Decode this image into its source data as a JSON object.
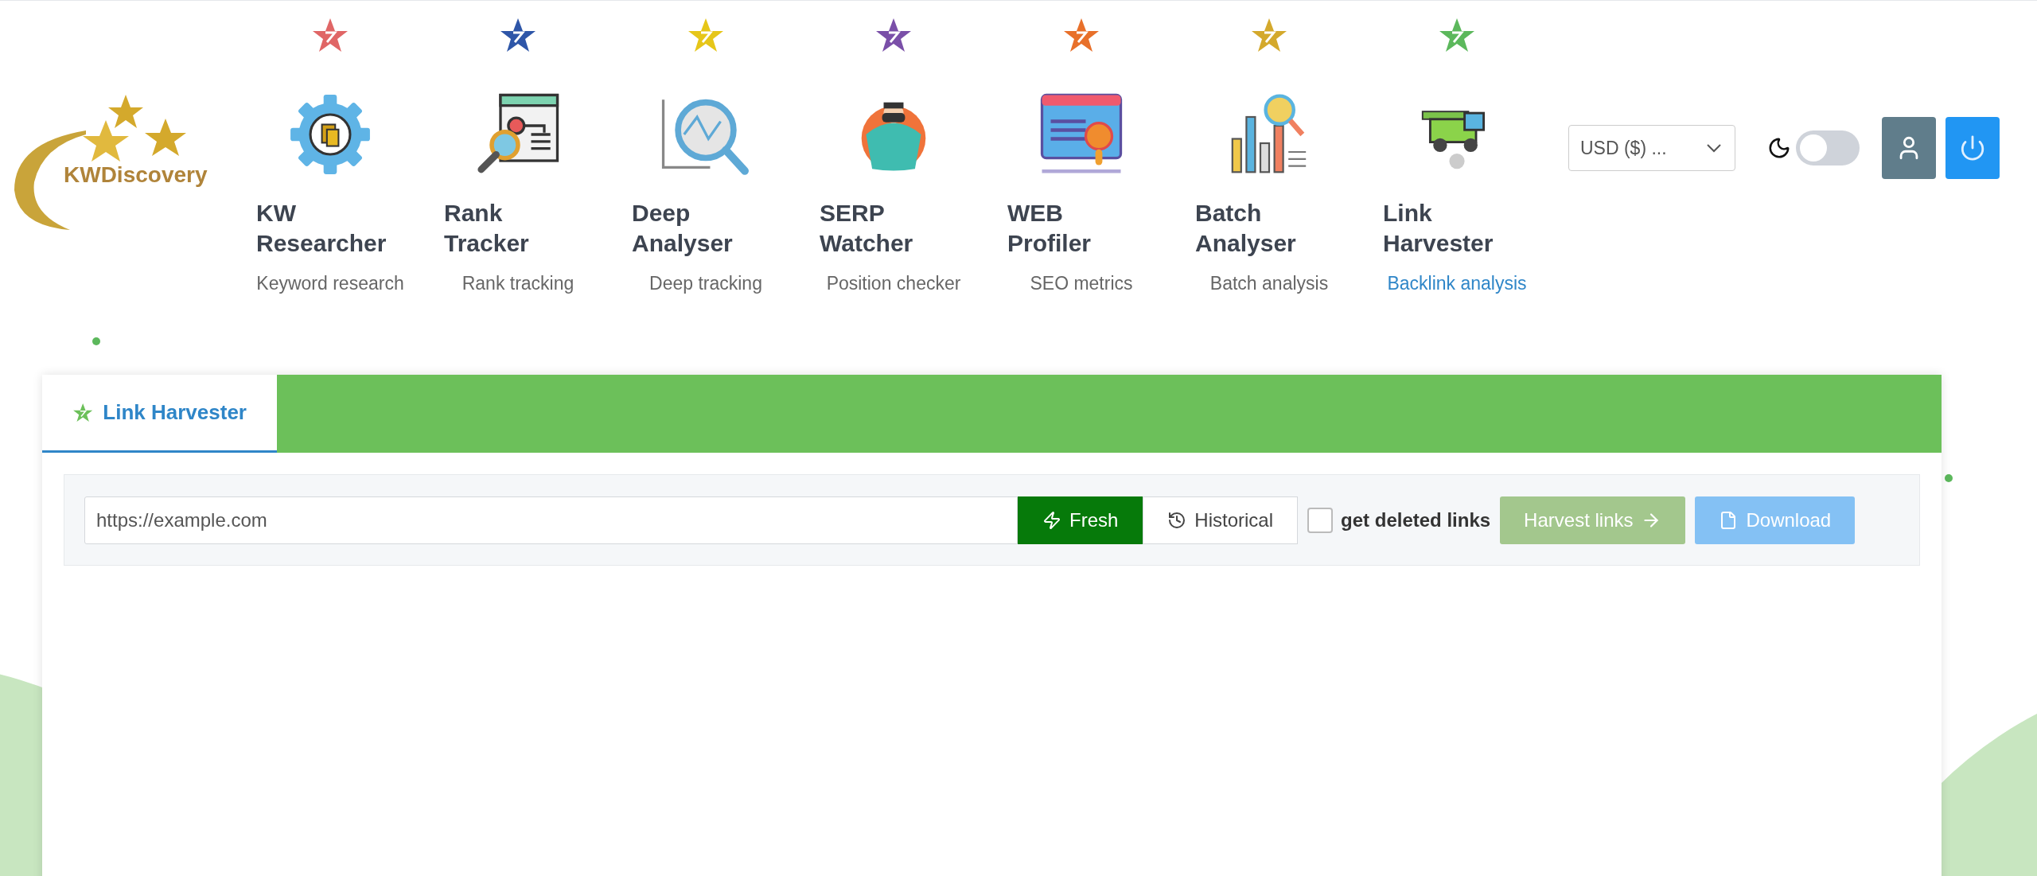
{
  "logo": {
    "text": "KWDiscovery"
  },
  "tools": [
    {
      "title": "KW Researcher",
      "subtitle": "Keyword research",
      "color": "#e06666",
      "selected": false
    },
    {
      "title": "Rank Tracker",
      "subtitle": "Rank tracking",
      "color": "#2e56a8",
      "selected": false
    },
    {
      "title": "Deep Analyser",
      "subtitle": "Deep tracking",
      "color": "#e6c619",
      "selected": false
    },
    {
      "title": "SERP Watcher",
      "subtitle": "Position checker",
      "color": "#7a4fa8",
      "selected": false
    },
    {
      "title": "WEB Profiler",
      "subtitle": "SEO metrics",
      "color": "#e8702a",
      "selected": false
    },
    {
      "title": "Batch Analyser",
      "subtitle": "Batch analysis",
      "color": "#d4a92c",
      "selected": false
    },
    {
      "title": "Link Harvester",
      "subtitle": "Backlink analysis",
      "color": "#5cb85c",
      "selected": true
    }
  ],
  "currency": {
    "value": "USD ($) ..."
  },
  "dark_mode": {
    "on": false
  },
  "tab": {
    "label": "Link Harvester",
    "selected": true
  },
  "form": {
    "url": "https://example.com",
    "modes": [
      {
        "label": "Fresh",
        "selected": true
      },
      {
        "label": "Historical",
        "selected": false
      }
    ],
    "deleted_links": {
      "label": "get deleted links",
      "checked": false
    },
    "harvest": {
      "label": "Harvest links",
      "disabled": true
    },
    "download": {
      "label": "Download",
      "disabled": true
    }
  }
}
